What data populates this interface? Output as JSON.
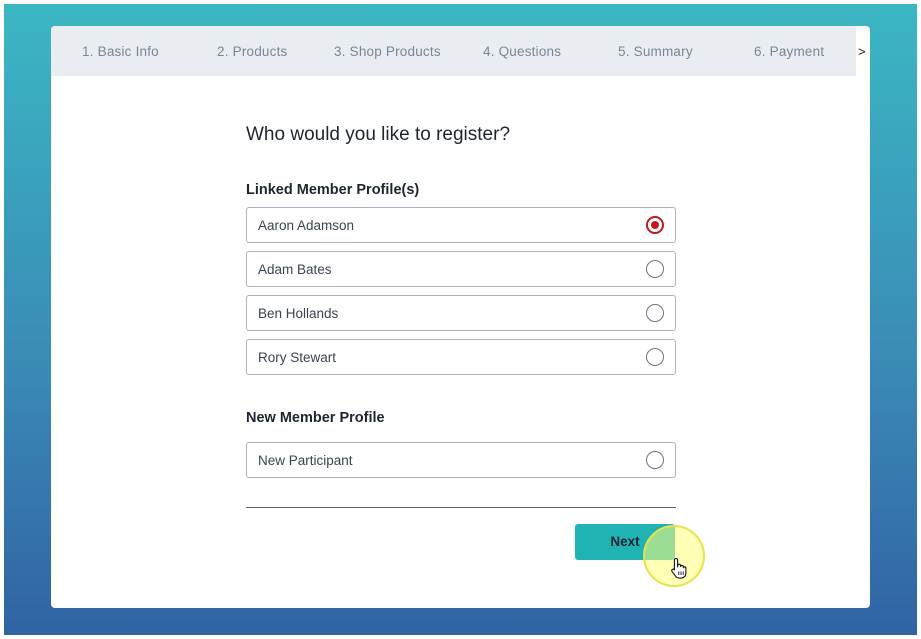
{
  "steps": [
    "1. Basic Info",
    "2. Products",
    "3. Shop Products",
    "4. Questions",
    "5. Summary",
    "6. Payment"
  ],
  "steps_more": ">",
  "title": "Who would you like to register?",
  "linked_section": {
    "heading": "Linked Member Profile(s)",
    "options": [
      {
        "label": "Aaron Adamson",
        "selected": true
      },
      {
        "label": "Adam Bates",
        "selected": false
      },
      {
        "label": "Ben Hollands",
        "selected": false
      },
      {
        "label": "Rory Stewart",
        "selected": false
      }
    ]
  },
  "new_section": {
    "heading": "New Member Profile",
    "options": [
      {
        "label": "New Participant",
        "selected": false
      }
    ]
  },
  "next_button": {
    "label": "Next"
  },
  "colors": {
    "accent": "#20b3b3",
    "selected_radio": "#c0181f"
  },
  "cursor_icon": "hand-pointer-icon"
}
